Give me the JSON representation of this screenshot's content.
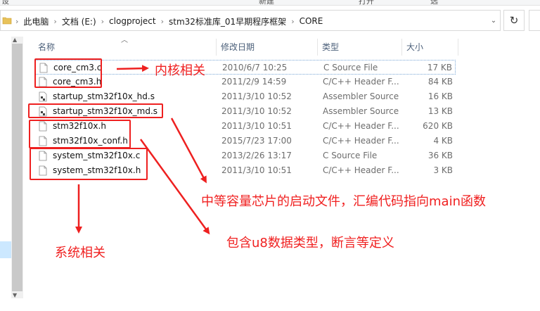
{
  "ribbon": {
    "clipped_left": "设",
    "clipped_mid": "新建",
    "clipped_right": "打开",
    "clipped_far": "选"
  },
  "address": {
    "breadcrumbs": [
      "此电脑",
      "文档 (E:)",
      "clogproject",
      "stm32标准库_01早期程序框架",
      "CORE"
    ],
    "separator": "›",
    "dropdown_glyph": "⌄",
    "refresh_glyph": "↻"
  },
  "columns": {
    "name": "名称",
    "date": "修改日期",
    "type": "类型",
    "size": "大小"
  },
  "files": [
    {
      "name": "core_cm3.c",
      "date": "2010/6/7 10:25",
      "type": "C Source File",
      "size": "17 KB",
      "icon": "c-file-icon",
      "selected": true
    },
    {
      "name": "core_cm3.h",
      "date": "2011/2/9 14:59",
      "type": "C/C++ Header F...",
      "size": "84 KB",
      "icon": "h-file-icon",
      "selected": false
    },
    {
      "name": "startup_stm32f10x_hd.s",
      "date": "2011/3/10 10:52",
      "type": "Assembler Source",
      "size": "16 KB",
      "icon": "asm-file-icon",
      "selected": false
    },
    {
      "name": "startup_stm32f10x_md.s",
      "date": "2011/3/10 10:52",
      "type": "Assembler Source",
      "size": "13 KB",
      "icon": "asm-file-icon",
      "selected": false
    },
    {
      "name": "stm32f10x.h",
      "date": "2011/3/10 10:51",
      "type": "C/C++ Header F...",
      "size": "620 KB",
      "icon": "h-file-icon",
      "selected": false
    },
    {
      "name": "stm32f10x_conf.h",
      "date": "2015/7/23 17:00",
      "type": "C/C++ Header F...",
      "size": "4 KB",
      "icon": "h-file-icon",
      "selected": false
    },
    {
      "name": "system_stm32f10x.c",
      "date": "2013/2/26 13:17",
      "type": "C Source File",
      "size": "36 KB",
      "icon": "c-file-icon",
      "selected": false
    },
    {
      "name": "system_stm32f10x.h",
      "date": "2011/3/10 10:51",
      "type": "C/C++ Header F...",
      "size": "3 KB",
      "icon": "h-file-icon",
      "selected": false
    }
  ],
  "annotations": {
    "kernel": "内核相关",
    "startup": "中等容量芯片的启动文件，汇编代码指向main函数",
    "types": "包含u8数据类型，断言等定义",
    "system": "系统相关"
  },
  "colors": {
    "annotation_red": "#ee2020",
    "header_text": "#4c607a",
    "secondary_text": "#6d6d6d"
  }
}
